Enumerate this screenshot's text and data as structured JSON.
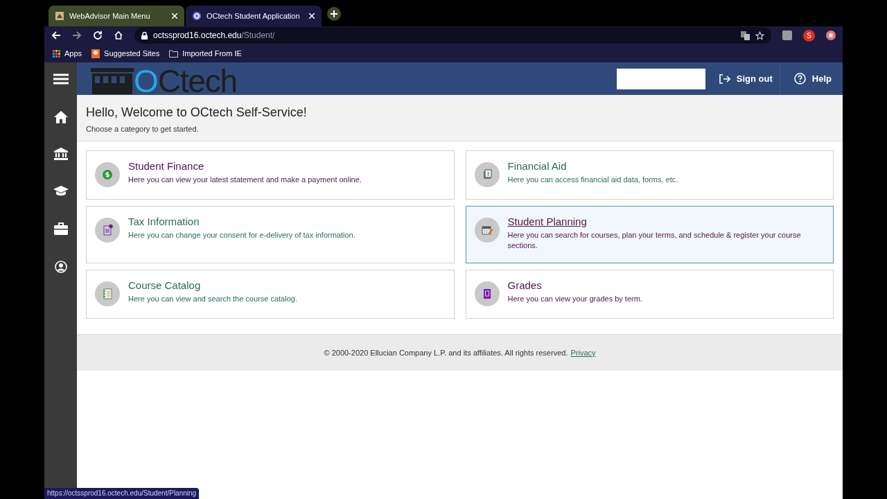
{
  "browser": {
    "tabs": [
      {
        "title": "WebAdvisor Main Menu",
        "selected": false
      },
      {
        "title": "OCtech Student Application",
        "selected": true
      }
    ],
    "address": {
      "host": "octssprod16.octech.edu",
      "path": "/Student/"
    },
    "bookmarks": [
      "Apps",
      "Suggested Sites",
      "Imported From IE"
    ],
    "profile_initial": "S"
  },
  "header": {
    "logo_text": "OCtech",
    "sign_out": "Sign out",
    "help": "Help"
  },
  "welcome": {
    "title": "Hello, Welcome to OCtech Self-Service!",
    "subtitle": "Choose a category to get started."
  },
  "categories": [
    {
      "kind": "finance",
      "title": "Student Finance",
      "description": "Here you can view your latest statement and make a payment online.",
      "color": "#4b1650",
      "selected": false
    },
    {
      "kind": "aid",
      "title": "Financial Aid",
      "description": "Here you can access financial aid data, forms, etc.",
      "color": "#2d6a58",
      "selected": false
    },
    {
      "kind": "tax",
      "title": "Tax Information",
      "description": "Here you can change your consent for e-delivery of tax information.",
      "color": "#2d6a58",
      "selected": false
    },
    {
      "kind": "planning",
      "title": "Student Planning",
      "description": "Here you can search for courses, plan your terms, and schedule & register your course sections.",
      "color": "#4b1650",
      "selected": true
    },
    {
      "kind": "catalog",
      "title": "Course Catalog",
      "description": "Here you can view and search the course catalog.",
      "color": "#2d6a58",
      "selected": false
    },
    {
      "kind": "grades",
      "title": "Grades",
      "description": "Here you can view your grades by term.",
      "color": "#4b1650",
      "selected": false
    }
  ],
  "footer": {
    "copyright": "© 2000-2020 Ellucian Company L.P. and its affiliates. All rights reserved.",
    "link": "Privacy"
  },
  "status_url": "https://octssprod16.octech.edu/Student/Planning"
}
